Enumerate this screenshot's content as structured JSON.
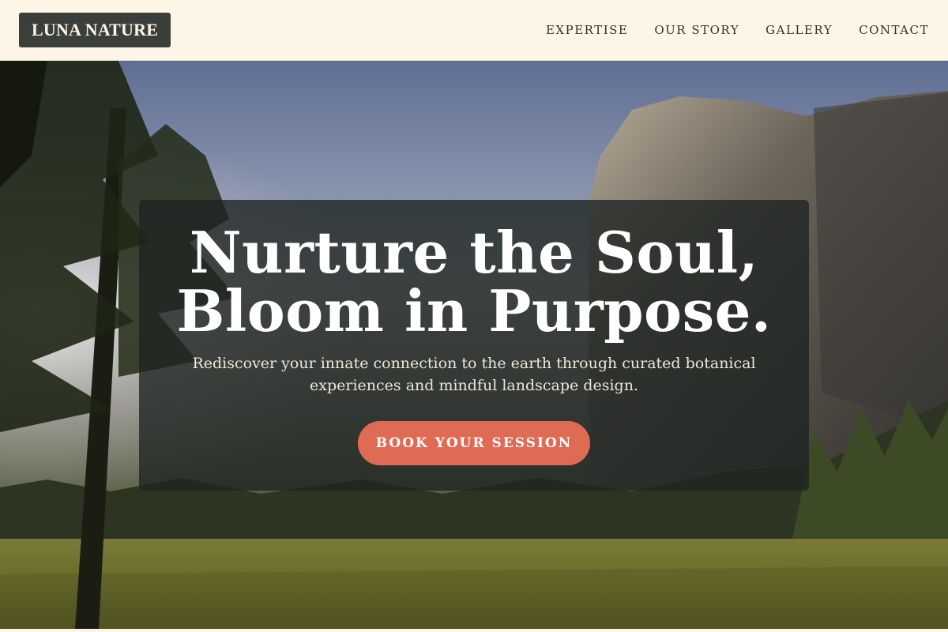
{
  "header": {
    "logo": "LUNA NATURE",
    "nav": [
      "EXPERTISE",
      "OUR STORY",
      "GALLERY",
      "CONTACT"
    ]
  },
  "hero": {
    "headline_line1": "Nurture the Soul,",
    "headline_line2": "Bloom in Purpose.",
    "subtext": "Rediscover your innate connection to the earth through curated botanical experiences and mindful landscape design.",
    "cta_label": "BOOK YOUR SESSION"
  },
  "colors": {
    "header_bg": "#fdf6e6",
    "logo_bg": "#3a3f3b",
    "panel_bg": "#1e2421",
    "cta_bg": "#e06b55",
    "nav_text": "#2e3330"
  },
  "icons": [
    "background-landscape-photo"
  ]
}
